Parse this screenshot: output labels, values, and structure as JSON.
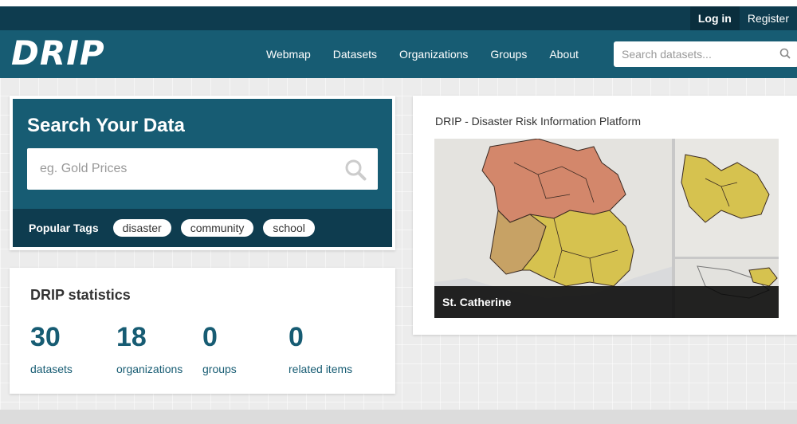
{
  "topbar": {
    "login": "Log in",
    "register": "Register"
  },
  "brand": {
    "logo": "DRIP"
  },
  "nav": {
    "items": [
      "Webmap",
      "Datasets",
      "Organizations",
      "Groups",
      "About"
    ],
    "search_placeholder": "Search datasets..."
  },
  "search_panel": {
    "title": "Search Your Data",
    "placeholder": "eg. Gold Prices",
    "popular_tags_label": "Popular Tags",
    "tags": [
      "disaster",
      "community",
      "school"
    ]
  },
  "stats": {
    "title": "DRIP statistics",
    "items": [
      {
        "value": "30",
        "label": "datasets"
      },
      {
        "value": "18",
        "label": "organizations"
      },
      {
        "value": "0",
        "label": "groups"
      },
      {
        "value": "0",
        "label": "related items"
      }
    ]
  },
  "featured": {
    "title": "DRIP - Disaster Risk Information Platform",
    "caption": "St. Catherine"
  },
  "colors": {
    "topbar": "#0e3c4f",
    "navbar": "#175c73",
    "accent": "#175c73"
  }
}
